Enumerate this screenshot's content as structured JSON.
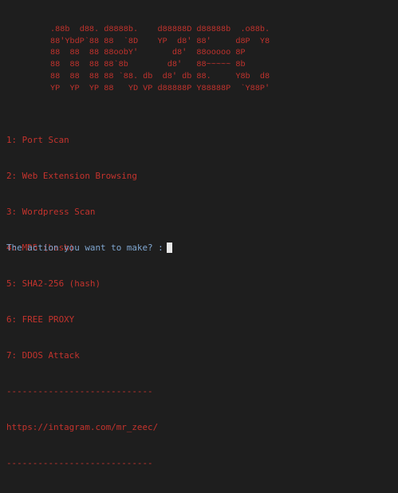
{
  "terminal": {
    "banner_lines": [
      "         .88b  d88. d8888b.    d88888D d88888b  .o88b.",
      "         88'YbdP`88 88  `8D    YP  d8' 88'     d8P  Y8",
      "         88  88  88 88oobY'       d8'  88ooooo 8P",
      "         88  88  88 88`8b        d8'   88~~~~~ 8b",
      "         88  88  88 88 `88. db  d8' db 88.     Y8b  d8",
      "         YP  YP  YP 88   YD VP d88888P Y88888P  `Y88P'"
    ],
    "menu_items": [
      "1: Port Scan",
      "2: Web Extension Browsing",
      "3: Wordpress Scan",
      "4: MD5 (hash)",
      "5: SHA2-256 (hash)",
      "6: FREE PROXY",
      "7: DDOS Attack"
    ],
    "separator_top": "----------------------------",
    "link": "https://intagram.com/mr_zeec/",
    "separator_bottom": "----------------------------",
    "prompt": "The action you want to make? :"
  },
  "colors": {
    "background": "#1e1e1e",
    "text_red": "#c4332d",
    "prompt_blue": "#7fa6d0",
    "cursor": "#e8e8e8"
  }
}
